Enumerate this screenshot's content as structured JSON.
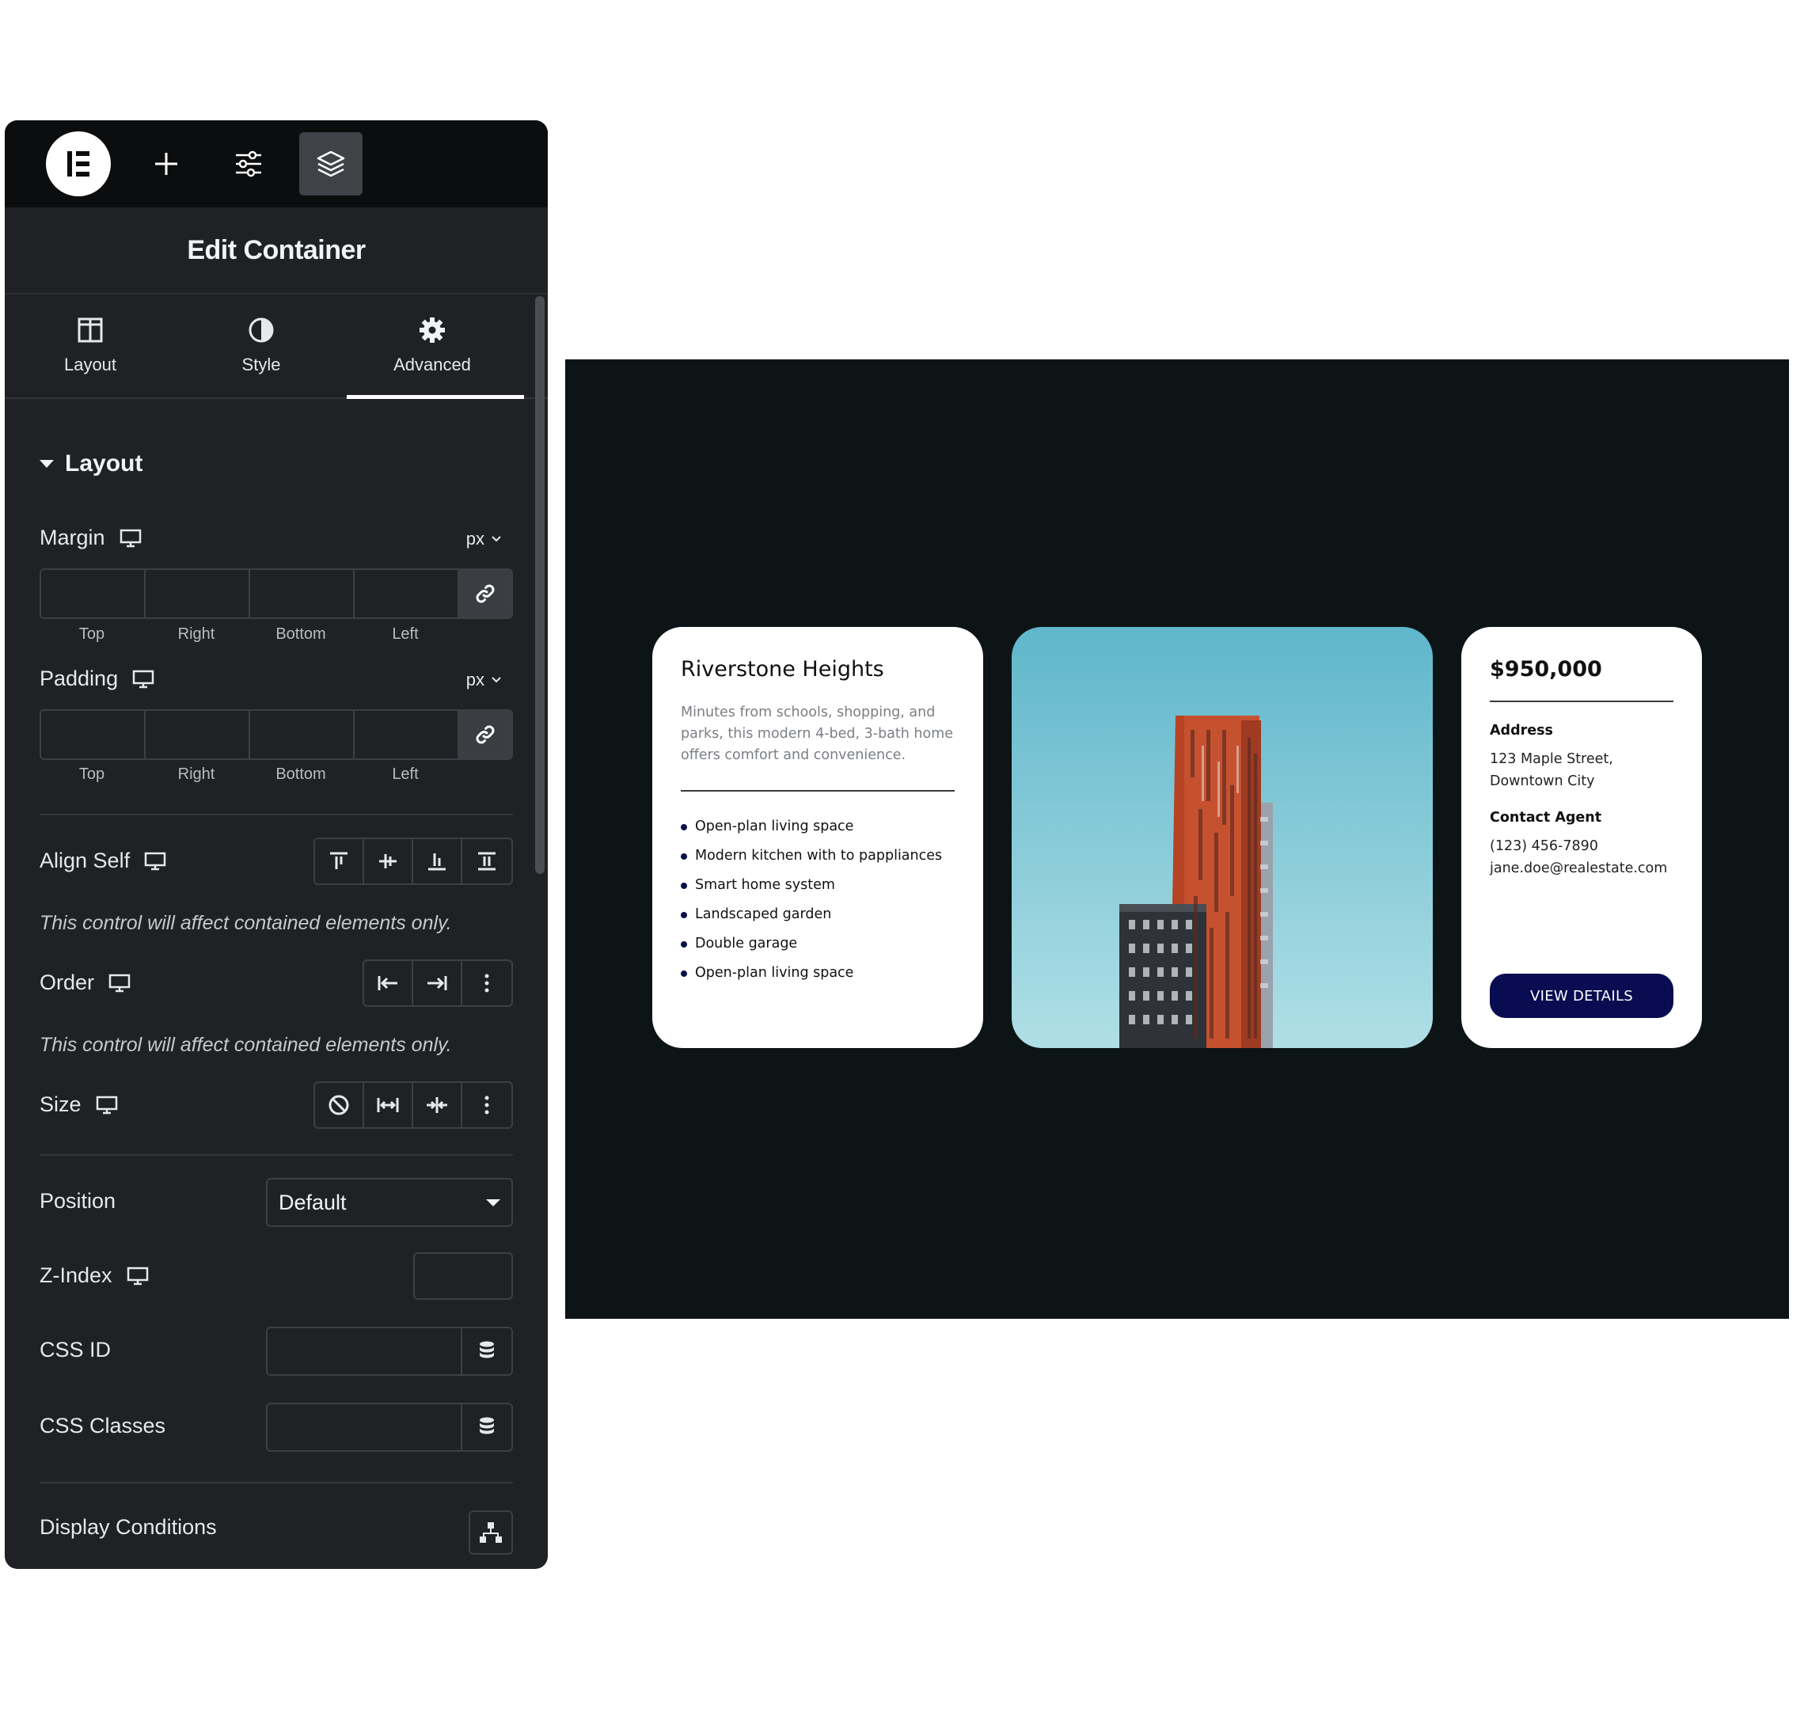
{
  "editor": {
    "title": "Edit Container",
    "tabs": [
      {
        "label": "Layout",
        "icon": "columns-icon"
      },
      {
        "label": "Style",
        "icon": "contrast-icon"
      },
      {
        "label": "Advanced",
        "icon": "gear-icon",
        "active": true
      }
    ],
    "section": {
      "title": "Layout"
    },
    "margin": {
      "label": "Margin",
      "unit": "px",
      "sides": [
        "Top",
        "Right",
        "Bottom",
        "Left"
      ]
    },
    "padding": {
      "label": "Padding",
      "unit": "px",
      "sides": [
        "Top",
        "Right",
        "Bottom",
        "Left"
      ]
    },
    "align_self": {
      "label": "Align Self",
      "note": "This control will affect contained elements only."
    },
    "order": {
      "label": "Order",
      "note": "This control will affect contained elements only."
    },
    "size": {
      "label": "Size"
    },
    "position": {
      "label": "Position",
      "value": "Default"
    },
    "z_index": {
      "label": "Z-Index"
    },
    "css_id": {
      "label": "CSS ID"
    },
    "css_classes": {
      "label": "CSS Classes"
    },
    "display_conditions": {
      "label": "Display Conditions"
    }
  },
  "preview": {
    "card1": {
      "title": "Riverstone Heights",
      "description": "Minutes from schools, shopping, and parks, this modern 4-bed, 3-bath home offers comfort and convenience.",
      "features": [
        "Open-plan living space",
        "Modern kitchen with to pappliances",
        "Smart home system",
        "Landscaped garden",
        "Double garage",
        "Open-plan living space"
      ]
    },
    "card3": {
      "price": "$950,000",
      "address_label": "Address",
      "address_line1": "123 Maple Street,",
      "address_line2": "Downtown City",
      "agent_label": "Contact Agent",
      "phone": "(123) 456-7890",
      "email": "jane.doe@realestate.com",
      "cta": "VIEW DETAILS"
    }
  },
  "colors": {
    "panel_bg": "#1f2124",
    "topbar_bg": "#0c0d0e",
    "preview_bg": "#0d1415",
    "cta_bg": "#0a0c52"
  }
}
